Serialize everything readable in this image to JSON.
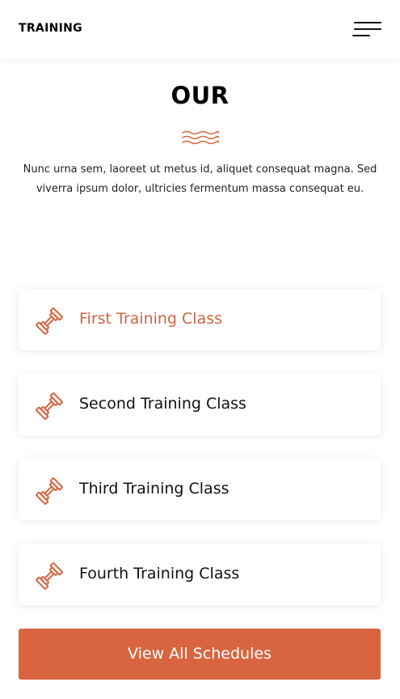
{
  "header": {
    "brand": "TRAINING",
    "menu_icon": "hamburger-menu-icon"
  },
  "section": {
    "title": "OUR",
    "divider_icon": "waves-icon",
    "intro": "Nunc urna sem, laoreet ut metus id, aliquet consequat magna. Sed viverra ipsum dolor, ultricies fermentum massa consequat eu."
  },
  "classes": [
    {
      "label": "First Training Class",
      "icon": "dumbbell-icon",
      "active": true
    },
    {
      "label": "Second Training Class",
      "icon": "dumbbell-icon",
      "active": false
    },
    {
      "label": "Third Training Class",
      "icon": "dumbbell-icon",
      "active": false
    },
    {
      "label": "Fourth Training Class",
      "icon": "dumbbell-icon",
      "active": false
    }
  ],
  "cta": {
    "label": "View All Schedules"
  },
  "colors": {
    "accent": "#d86540",
    "active_text": "#cf6540",
    "text": "#111111",
    "background": "#ffffff"
  }
}
